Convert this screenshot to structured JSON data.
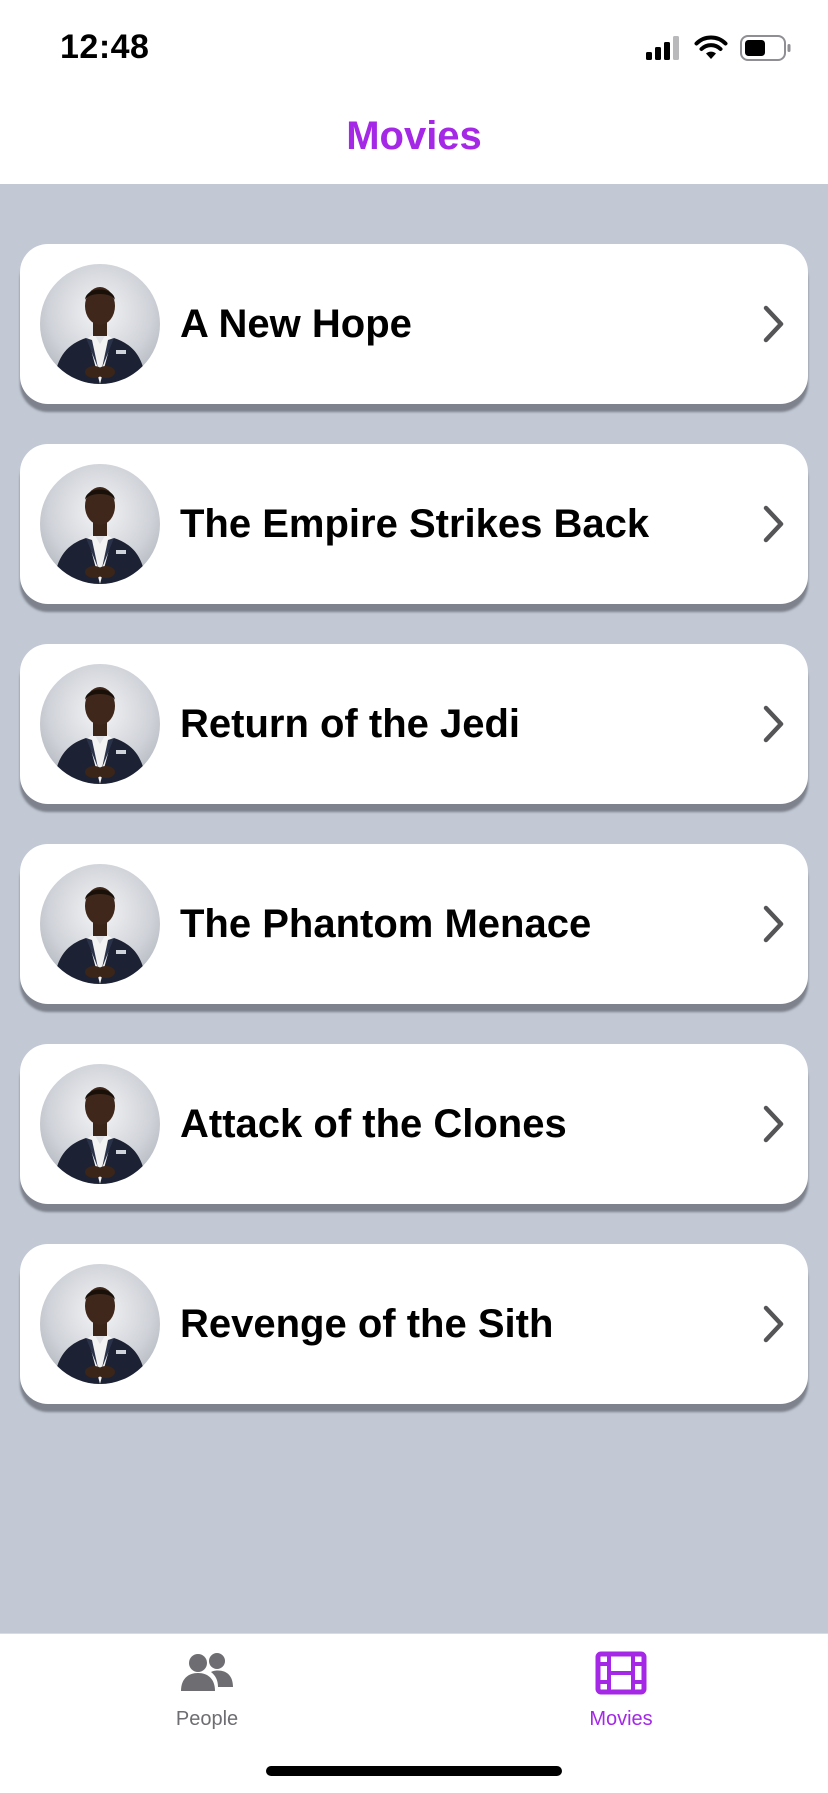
{
  "status_bar": {
    "time": "12:48"
  },
  "header": {
    "title": "Movies"
  },
  "colors": {
    "accent": "#a428e6",
    "inactive": "#6e6e72",
    "background": "#c2c9d5"
  },
  "movies": [
    {
      "title": "A New Hope"
    },
    {
      "title": "The Empire Strikes Back"
    },
    {
      "title": "Return of the Jedi"
    },
    {
      "title": "The Phantom Menace"
    },
    {
      "title": "Attack of the Clones"
    },
    {
      "title": "Revenge of the Sith"
    }
  ],
  "tabs": [
    {
      "label": "People",
      "icon": "people-icon",
      "active": false
    },
    {
      "label": "Movies",
      "icon": "film-icon",
      "active": true
    }
  ]
}
